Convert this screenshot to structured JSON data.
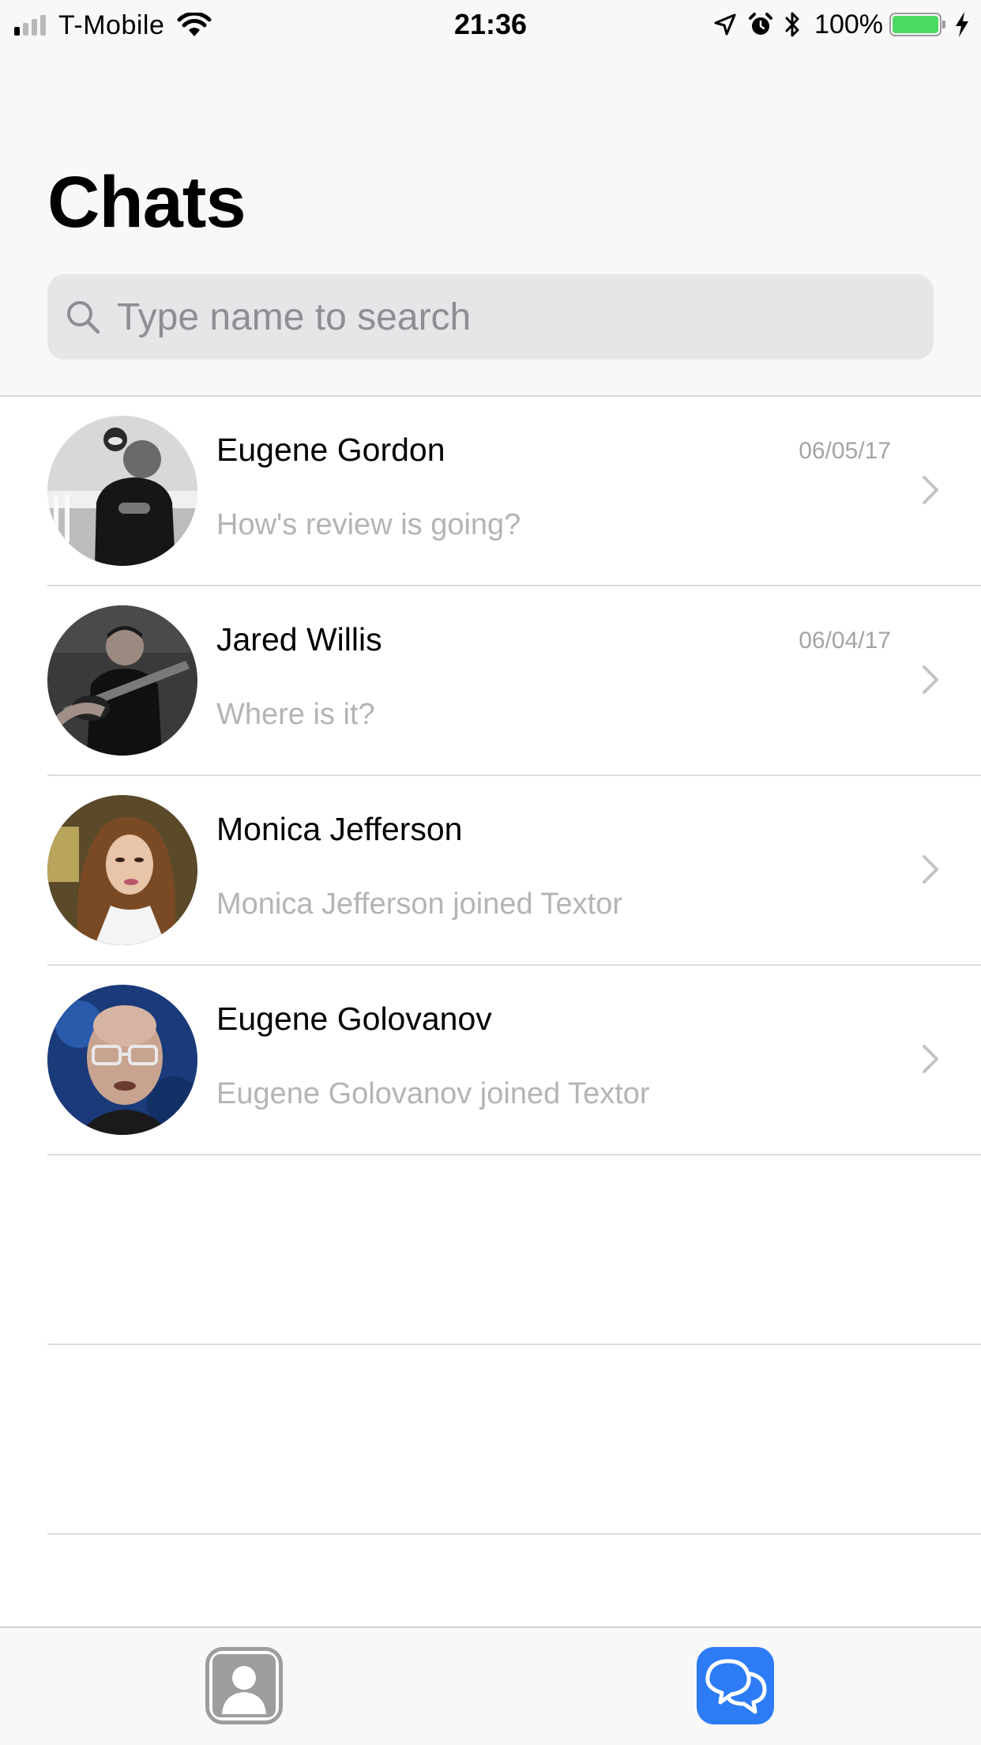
{
  "status_bar": {
    "carrier": "T-Mobile",
    "time": "21:36",
    "battery_percent": "100%",
    "battery_level": 1.0,
    "signal_bars_on": 1,
    "signal_bars_total": 4,
    "icons": [
      "signal-icon",
      "wifi-icon",
      "location-arrow-icon",
      "alarm-icon",
      "bluetooth-icon",
      "battery-icon",
      "charging-bolt-icon"
    ]
  },
  "header": {
    "title": "Chats"
  },
  "search": {
    "placeholder": "Type name to search",
    "value": "",
    "icon": "search-icon"
  },
  "chats": [
    {
      "name": "Eugene Gordon",
      "preview": "How's review is going?",
      "date": "06/05/17",
      "avatar": "photo-avatar"
    },
    {
      "name": "Jared Willis",
      "preview": "Where is it?",
      "date": "06/04/17",
      "avatar": "photo-avatar"
    },
    {
      "name": "Monica Jefferson",
      "preview": "Monica Jefferson joined Textor",
      "date": "",
      "avatar": "photo-avatar"
    },
    {
      "name": "Eugene Golovanov",
      "preview": "Eugene Golovanov joined Textor",
      "date": "",
      "avatar": "photo-avatar"
    }
  ],
  "tab_bar": {
    "tabs": [
      {
        "id": "contacts",
        "icon": "contacts-icon",
        "active": false
      },
      {
        "id": "chats",
        "icon": "chats-bubble-icon",
        "active": true
      }
    ]
  },
  "colors": {
    "accent": "#2d7cf6",
    "battery": "#4cd964",
    "secondary_text": "#b4b4b8",
    "date_text": "#a4a4a8",
    "separator": "#dcdcde",
    "header_bg": "#f8f8f8",
    "search_bg": "#e6e6e8"
  }
}
